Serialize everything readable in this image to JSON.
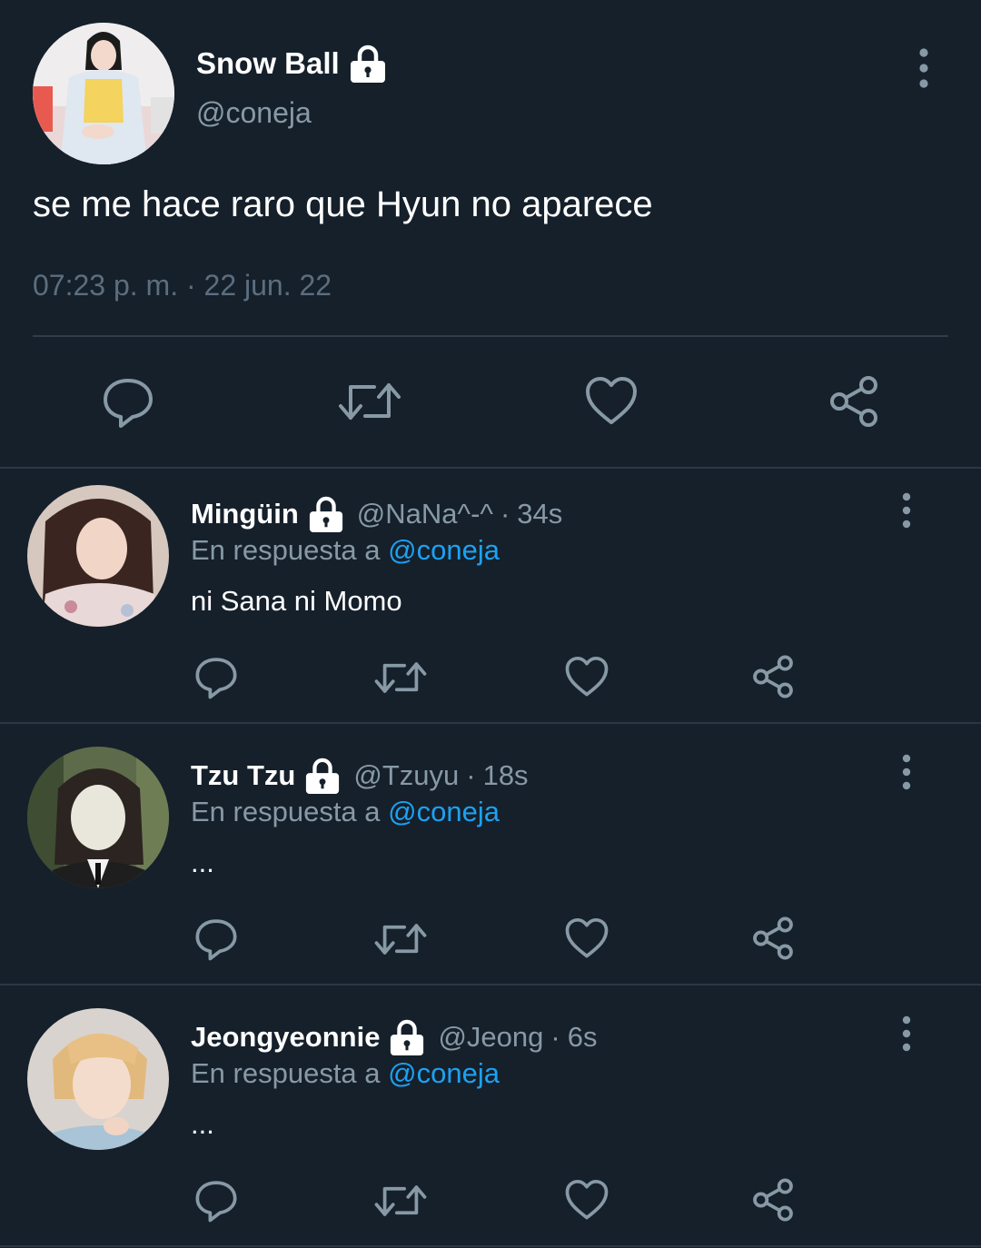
{
  "main_tweet": {
    "display_name": "Snow Ball",
    "handle": "@coneja",
    "text": "se me hace raro que Hyun no aparece",
    "timestamp": "07:23 p. m. · 22 jun. 22",
    "locked_icon": "lock-icon",
    "actions": [
      "reply-icon",
      "retweet-icon",
      "like-icon",
      "share-icon"
    ]
  },
  "replies": [
    {
      "display_name": "Mingüin",
      "handle": "@NaNa^-^",
      "time": "34s",
      "in_reply_prefix": "En respuesta a",
      "in_reply_mention": "@coneja",
      "text": "ni Sana ni Momo"
    },
    {
      "display_name": "Tzu Tzu",
      "handle": "@Tzuyu",
      "time": "18s",
      "in_reply_prefix": "En respuesta a",
      "in_reply_mention": "@coneja",
      "text": "..."
    },
    {
      "display_name": "Jeongyeonnie",
      "handle": "@Jeong",
      "time": "6s",
      "in_reply_prefix": "En respuesta a",
      "in_reply_mention": "@coneja",
      "text": "..."
    }
  ],
  "colors": {
    "background": "#15202b",
    "secondary_text": "#8899a6",
    "mention": "#1da1f2",
    "icon": "#8899a6"
  }
}
